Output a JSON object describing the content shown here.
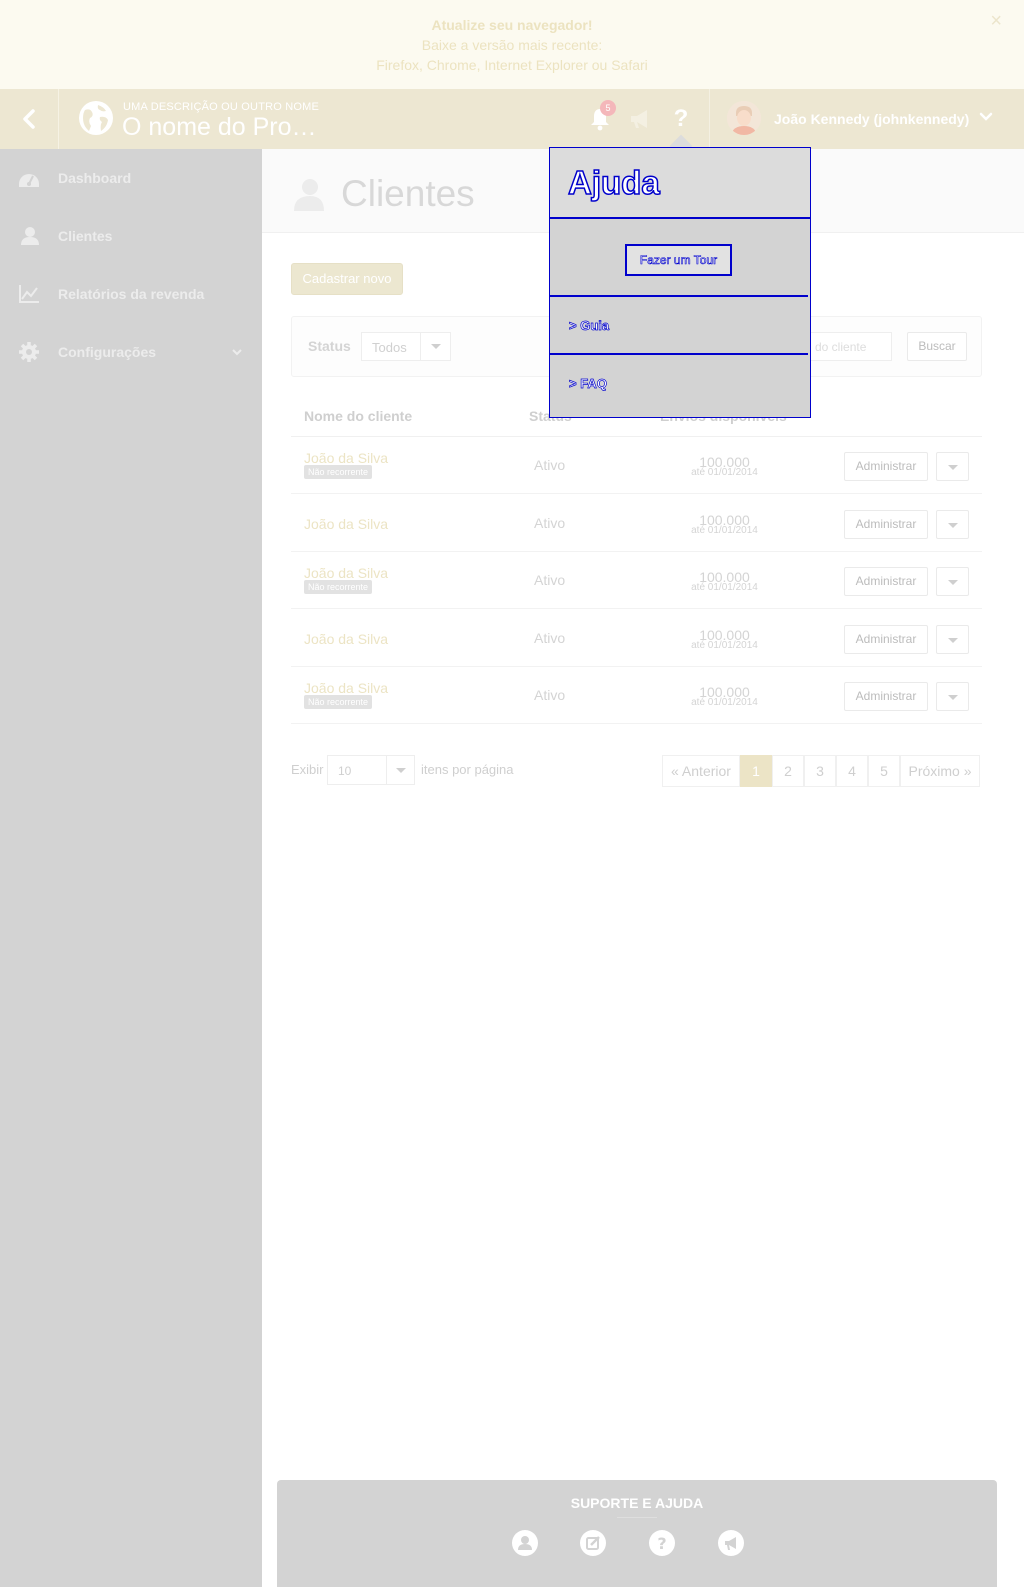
{
  "browser_warning": {
    "title": "Atualize seu navegador!",
    "line1": "Baixe a versão mais recente:",
    "line2": "Firefox, Chrome, Internet Explorer ou Safari",
    "close": "×"
  },
  "topbar": {
    "product_description": "UMA DESCRIÇÃO OU OUTRO NOME",
    "product_name": "O nome do Pro…",
    "notifications_count": "5",
    "help_glyph": "?",
    "user_name": "João Kennedy (johnkennedy)",
    "icons": [
      "chevron-left-icon",
      "globe-icon",
      "bell-icon",
      "megaphone-icon",
      "question-icon",
      "chevron-down-icon"
    ]
  },
  "sidebar": {
    "items": [
      {
        "label": "Dashboard",
        "icon": "dashboard-icon"
      },
      {
        "label": "Clientes",
        "icon": "user-icon"
      },
      {
        "label": "Relatórios da revenda",
        "icon": "line-chart-icon"
      },
      {
        "label": "Configurações",
        "icon": "gear-icon"
      }
    ]
  },
  "main": {
    "title": "Clientes",
    "new_button": "Cadastrar novo",
    "filter": {
      "status_label": "Status",
      "status_value": "Todos",
      "search_placeholder": "do cliente",
      "search_button": "Buscar"
    },
    "columns": [
      "Nome do cliente",
      "Status",
      "Envios disponíveis"
    ],
    "rows": [
      {
        "name": "João da Silva",
        "tag": "Não recorrente",
        "status": "Ativo",
        "qty": "100.000",
        "until": "até 01/01/2014",
        "action": "Administrar"
      },
      {
        "name": "João da Silva",
        "tag": "",
        "status": "Ativo",
        "qty": "100.000",
        "until": "até 01/01/2014",
        "action": "Administrar"
      },
      {
        "name": "João da Silva",
        "tag": "Não recorrente",
        "status": "Ativo",
        "qty": "100.000",
        "until": "até 01/01/2014",
        "action": "Administrar"
      },
      {
        "name": "João da Silva",
        "tag": "",
        "status": "Ativo",
        "qty": "100.000",
        "until": "até 01/01/2014",
        "action": "Administrar"
      },
      {
        "name": "João da Silva",
        "tag": "Não recorrente",
        "status": "Ativo",
        "qty": "100.000",
        "until": "até 01/01/2014",
        "action": "Administrar"
      }
    ],
    "pagination": {
      "show_label": "Exibir",
      "per_page": "10",
      "per_page_label": "itens por página",
      "prev": "« Anterior",
      "pages": [
        "1",
        "2",
        "3",
        "4",
        "5"
      ],
      "current_page": "1",
      "next": "Próximo »"
    }
  },
  "support": {
    "title": "SUPORTE E AJUDA",
    "icons": [
      "user-icon",
      "edit-icon",
      "question-icon",
      "megaphone-icon"
    ]
  },
  "help_popover": {
    "title": "Ajuda",
    "tour_button": "Fazer um Tour",
    "links": [
      "> Guia",
      "> FAQ"
    ]
  },
  "colors": {
    "topbar_bg": "#ede7d2",
    "sidebar_bg": "#d3d3d3",
    "accent": "#ece4c6",
    "badge": "#f4b7ba",
    "popover_outline": "#0000cc"
  }
}
